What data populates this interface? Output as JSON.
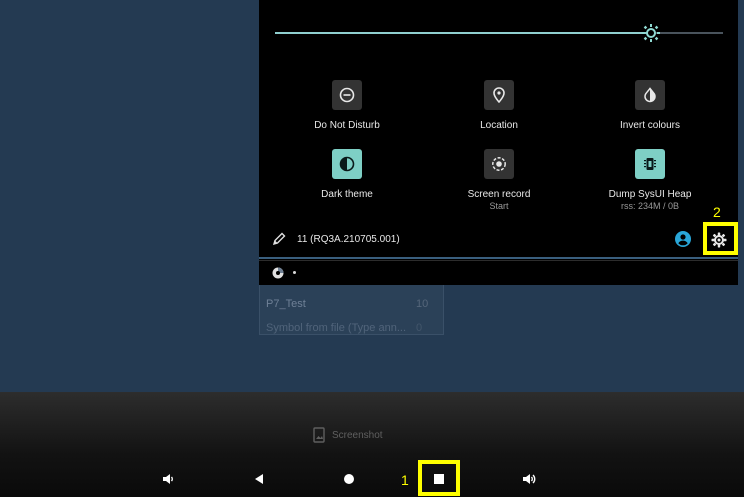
{
  "background_app_list": {
    "rows": [
      {
        "name": "P7_Test",
        "count": "10"
      },
      {
        "name": "Symbol from file (Type ann...",
        "count": "0"
      }
    ]
  },
  "quick_settings": {
    "brightness_level": 0.84,
    "tiles": [
      {
        "label": "Do Not Disturb",
        "sub": "",
        "icon": "do-not-disturb-icon",
        "on": false
      },
      {
        "label": "Location",
        "sub": "",
        "icon": "location-pin-icon",
        "on": false
      },
      {
        "label": "Invert colours",
        "sub": "",
        "icon": "invert-colours-icon",
        "on": false
      },
      {
        "label": "Dark theme",
        "sub": "",
        "icon": "dark-theme-icon",
        "on": true
      },
      {
        "label": "Screen record",
        "sub": "Start",
        "icon": "screen-record-icon",
        "on": false
      },
      {
        "label": "Dump SysUI Heap",
        "sub": "rss: 234M / 0B",
        "icon": "memory-chip-icon",
        "on": true
      }
    ],
    "footer": {
      "build": "11 (RQ3A.210705.001)"
    }
  },
  "annotations": {
    "settings_number": "2",
    "overview_number": "1",
    "highlight_color": "#ffff00"
  },
  "screenshot_button": {
    "label": "Screenshot"
  },
  "nav_bar": {
    "buttons": [
      "volume-down-icon",
      "back-icon",
      "home-icon",
      "overview-icon",
      "volume-up-icon"
    ]
  },
  "colors": {
    "desktop": "#243a52",
    "accent": "#7ecfc5"
  }
}
